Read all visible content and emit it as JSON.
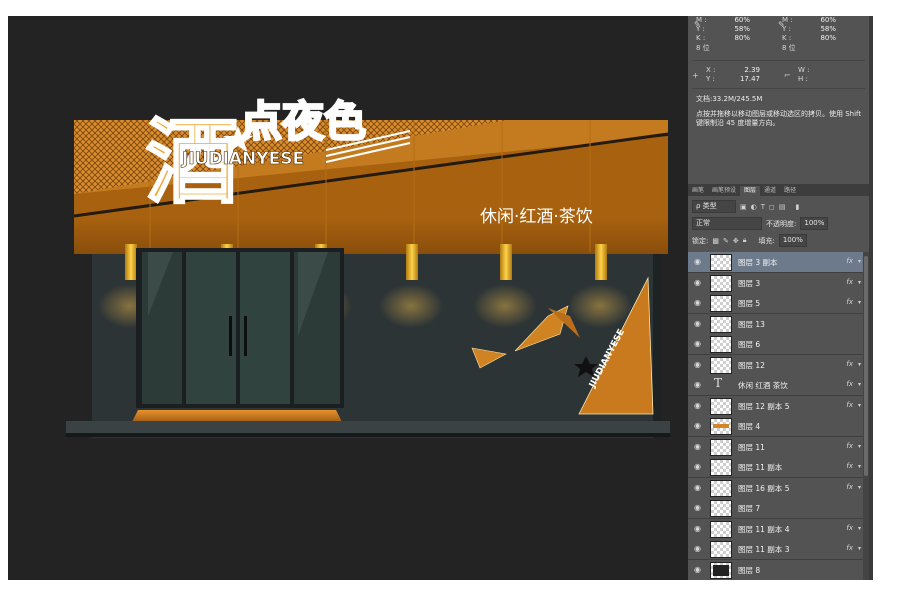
{
  "sign": {
    "title_big_char": "酒",
    "title_rest": "点夜色",
    "pinyin": "JIUDIANYESE",
    "slogan": "休闲·红酒·茶饮",
    "diagonal_text": "JIUDIANYESE"
  },
  "info": {
    "cmyk_left": [
      {
        "k": "M :",
        "v": "60%"
      },
      {
        "k": "Y :",
        "v": "58%"
      },
      {
        "k": "K :",
        "v": "80%"
      }
    ],
    "cmyk_right": [
      {
        "k": "M :",
        "v": "60%"
      },
      {
        "k": "Y :",
        "v": "58%"
      },
      {
        "k": "K :",
        "v": "80%"
      }
    ],
    "bits_left": "8 位",
    "bits_right": "8 位",
    "x_label": "X :",
    "x_value": "2.39",
    "y_label": "Y :",
    "y_value": "17.47",
    "w_label": "W :",
    "h_label": "H :",
    "doc_size": "文档:33.2M/245.5M",
    "hint": "点按并拖移以移动图层或移动选区的拷贝。使用 Shift 键限制沿 45 度增量方向。"
  },
  "tabs": [
    "画笔",
    "画笔预设",
    "图层",
    "通道",
    "路径"
  ],
  "active_tab": "图层",
  "filter": {
    "label": "ρ 类型"
  },
  "blend": {
    "mode": "正常",
    "opacity_label": "不透明度:",
    "opacity": "100%"
  },
  "lock": {
    "label": "锁定:",
    "fill_label": "填充:",
    "fill": "100%"
  },
  "layers": [
    {
      "name": "图层 3 副本",
      "fx": "fx",
      "selected": true,
      "thumb": "checker"
    },
    {
      "name": "图层 3",
      "fx": "fx",
      "thumb": "checker"
    },
    {
      "name": "图层 5",
      "fx": "fx",
      "thumb": "checker"
    },
    {
      "name": "图层 13",
      "fx": "",
      "thumb": "checker"
    },
    {
      "name": "图层 6",
      "fx": "",
      "thumb": "checker"
    },
    {
      "name": "图层 12",
      "fx": "fx",
      "thumb": "checker"
    },
    {
      "name": "休闲 红酒 茶饮",
      "fx": "fx",
      "thumb": "text"
    },
    {
      "name": "图层 12 副本 5",
      "fx": "fx",
      "thumb": "checker"
    },
    {
      "name": "图层 4",
      "fx": "",
      "thumb": "orange"
    },
    {
      "name": "图层 11",
      "fx": "fx",
      "thumb": "checker"
    },
    {
      "name": "图层 11 副本",
      "fx": "fx",
      "thumb": "checker"
    },
    {
      "name": "图层 16 副本 5",
      "fx": "fx",
      "thumb": "checker"
    },
    {
      "name": "图层 7",
      "fx": "",
      "thumb": "checker"
    },
    {
      "name": "图层 11 副本 4",
      "fx": "fx",
      "thumb": "checker"
    },
    {
      "name": "图层 11 副本 3",
      "fx": "fx",
      "thumb": "checker"
    },
    {
      "name": "图层 8",
      "fx": "",
      "thumb": "dark"
    }
  ],
  "colors": {
    "orange": "#c97a1f",
    "canvas": "#232323",
    "panel": "#535353",
    "selected": "#6c7a8c"
  }
}
